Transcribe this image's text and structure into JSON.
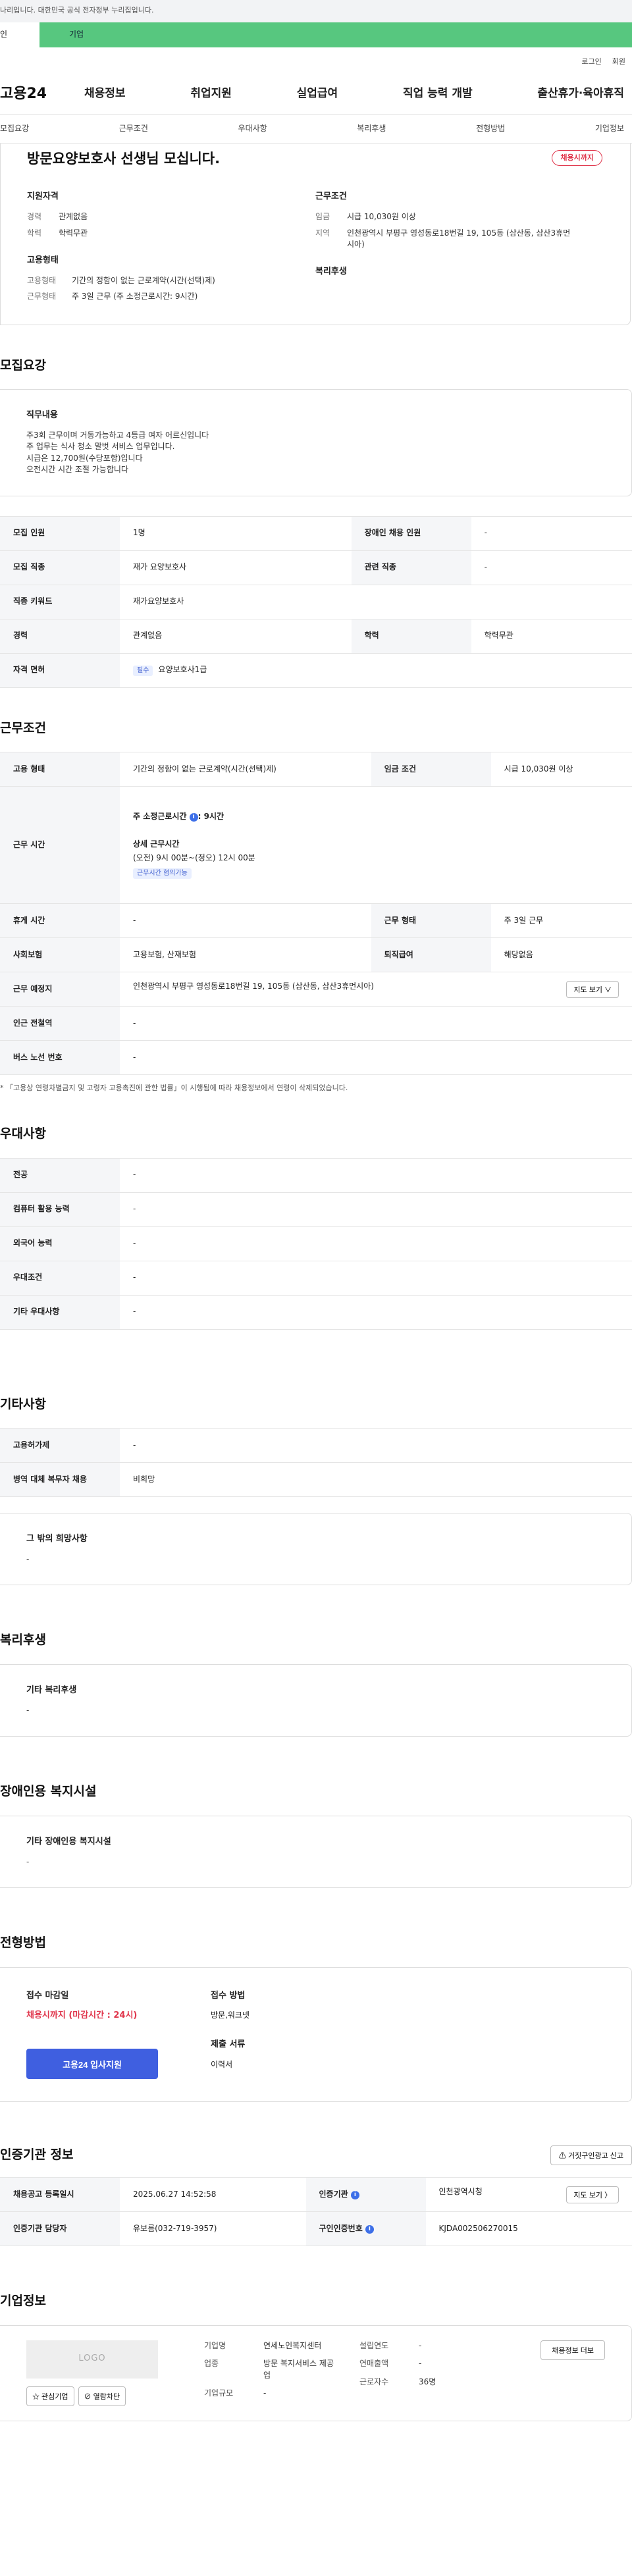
{
  "top_notice": "나리입니다. 대한민국 공식 전자정부 누리집입니다.",
  "user_tabs": {
    "personal": "인",
    "company": "기업"
  },
  "utility": {
    "login": "로그인",
    "join": "회원"
  },
  "gnb": {
    "logo": "고용24",
    "menu": [
      "채용정보",
      "취업지원",
      "실업급여",
      "직업 능력 개발",
      "출산휴가·육아휴직"
    ]
  },
  "anchor_nav": [
    "모집요강",
    "근무조건",
    "우대사항",
    "복리후생",
    "전형방법",
    "기업정보"
  ],
  "summary": {
    "title": "방문요양보호사 선생님 모십니다.",
    "status_badge": "채용시까지",
    "qual_title": "지원자격",
    "qual": [
      {
        "k": "경력",
        "v": "관계없음"
      },
      {
        "k": "학력",
        "v": "학력무관"
      }
    ],
    "emp_title": "고용형태",
    "emp": [
      {
        "k": "고용형태",
        "v": "기간의 정함이 없는 근로계약(시간(선택)제)"
      },
      {
        "k": "근무형태",
        "v": "주 3일 근무 (주 소정근로시간: 9시간)"
      }
    ],
    "cond_title": "근무조건",
    "cond": [
      {
        "k": "임금",
        "v": "시급 10,030원 이상"
      },
      {
        "k": "지역",
        "v": "인천광역시 부평구 영성동로18번길 19, 105동 (삼산동, 삼산3휴먼시아)"
      }
    ],
    "welfare_title": "복리후생"
  },
  "recruit": {
    "title": "모집요강",
    "duty_title": "직무내용",
    "duty_lines": [
      "주3회  근무이며 거동가능하고  4등급 여자 어르신입니다",
      "주 업무는 식사 청소 말벗 서비스 업무입니다.",
      "시급은 12,700원(수당포함)입니다",
      "오전시간 시간 조절 가능합니다"
    ],
    "rows": [
      {
        "k1": "모집 인원",
        "v1": "1명",
        "k2": "장애인 채용 인원",
        "v2": "-"
      },
      {
        "k1": "모집 직종",
        "v1": "재가 요양보호사",
        "k2": "관련 직종",
        "v2": "-"
      },
      {
        "k1": "직종 키워드",
        "v1": "재가요양보호사"
      },
      {
        "k1": "경력",
        "v1": "관계없음",
        "k2": "학력",
        "v2": "학력무관"
      },
      {
        "k1": "자격 면허",
        "tag": "필수",
        "v1": "요양보호사1급"
      }
    ]
  },
  "work": {
    "title": "근무조건",
    "emp_type_k": "고용 형태",
    "emp_type_v": "기간의 정함이 없는 근로계약(시간(선택)제)",
    "wage_k": "임금 조건",
    "wage_v": "시급 10,030원 이상",
    "time_k": "근무 시간",
    "weekly_label": "주 소정근로시간",
    "weekly_value": ": 9시간",
    "detail_title": "상세 근무시간",
    "detail_value": "(오전) 9시 00분~(정오) 12시 00분",
    "detail_tag": "근무시간 협의가능",
    "rest_k": "휴게 시간",
    "rest_v": "-",
    "shift_k": "근무 형태",
    "shift_v": "주 3일 근무",
    "ins_k": "사회보험",
    "ins_v": "고용보험, 산재보험",
    "sev_k": "퇴직급여",
    "sev_v": "해당없음",
    "loc_k": "근무 예정지",
    "loc_v": "인천광역시 부평구 영성동로18번길 19, 105동 (삼산동, 삼산3휴먼시아)",
    "map_btn": "지도 보기 ∨",
    "subway_k": "인근 전철역",
    "subway_v": "-",
    "bus_k": "버스 노선 번호",
    "bus_v": "-",
    "note": "* 「고용상 연령차별금지 및 고령자 고용촉진에 관한 법률」이 시행됨에 따라 채용정보에서 연령이 삭제되었습니다."
  },
  "pref": {
    "title": "우대사항",
    "rows": [
      {
        "k": "전공",
        "v": "-"
      },
      {
        "k": "컴퓨터 활용 능력",
        "v": "-"
      },
      {
        "k": "외국어 능력",
        "v": "-"
      },
      {
        "k": "우대조건",
        "v": "-"
      },
      {
        "k": "기타 우대사항",
        "v": "-"
      }
    ]
  },
  "etc": {
    "title": "기타사항",
    "rows": [
      {
        "k": "고용허가제",
        "v": "-"
      },
      {
        "k": "병역 대체 복무자 채용",
        "v": "비희망"
      }
    ],
    "other_title": "그 밖의 희망사항",
    "other_v": "-"
  },
  "welfare": {
    "title": "복리후생",
    "box_title": "기타 복리후생",
    "box_v": "-"
  },
  "disability": {
    "title": "장애인용 복지시설",
    "box_title": "기타 장애인용 복지시설",
    "box_v": "-"
  },
  "apply": {
    "title": "전형방법",
    "deadline_title": "접수 마감일",
    "deadline_v": "채용시까지 (마감시간 : 24시)",
    "apply_btn": "고용24 입사지원",
    "method_title": "접수 방법",
    "method_v": "방문,워크넷",
    "docs_title": "제출 서류",
    "docs_v": "이력서"
  },
  "cert": {
    "title": "인증기관 정보",
    "report_btn": "거짓구인광고 신고",
    "rows": [
      {
        "k1": "채용공고 등록일시",
        "v1": "2025.06.27 14:52:58",
        "k2": "인증기관",
        "v2": "인천광역시청",
        "btn": "지도 보기 〉"
      },
      {
        "k1": "인증기관 담당자",
        "v1": "유보름(032-719-3957)",
        "k2": "구인인증번호",
        "v2": "KJDA002506270015"
      }
    ]
  },
  "company": {
    "title": "기업정보",
    "logo": "LOGO",
    "fav_btn": "☆ 관심기업",
    "block_btn": "⊘ 열람차단",
    "rows_a": [
      {
        "k": "기업명",
        "v": "연세노인복지센터"
      },
      {
        "k": "업종",
        "v": "방문 복지서비스 제공업"
      },
      {
        "k": "기업규모",
        "v": "-"
      }
    ],
    "rows_b": [
      {
        "k": "설립연도",
        "v": "-"
      },
      {
        "k": "연매출액",
        "v": "-"
      },
      {
        "k": "근로자수",
        "v": "36명"
      }
    ],
    "more_btn": "채용정보 더보"
  }
}
